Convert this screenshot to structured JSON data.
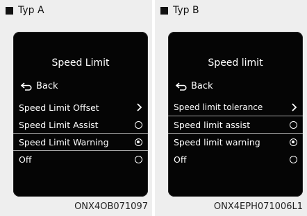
{
  "panels": [
    {
      "label": "Typ A",
      "title": "Speed Limit",
      "back": "Back",
      "items": [
        {
          "label": "Speed Limit Offset",
          "control": "chevron"
        },
        {
          "label": "Speed Limit Assist",
          "control": "radio",
          "selected": false
        },
        {
          "label": "Speed Limit Warning",
          "control": "radio",
          "selected": true
        },
        {
          "label": "Off",
          "control": "radio",
          "selected": false
        }
      ],
      "code": "ONX4OB071097"
    },
    {
      "label": "Typ B",
      "title": "Speed limit",
      "back": "Back",
      "items": [
        {
          "label": "Speed limit tolerance",
          "control": "chevron"
        },
        {
          "label": "Speed limit assist",
          "control": "radio",
          "selected": false
        },
        {
          "label": "Speed limit warning",
          "control": "radio",
          "selected": true
        },
        {
          "label": "Off",
          "control": "radio",
          "selected": false
        }
      ],
      "code": "ONX4EPH071006L1"
    }
  ]
}
